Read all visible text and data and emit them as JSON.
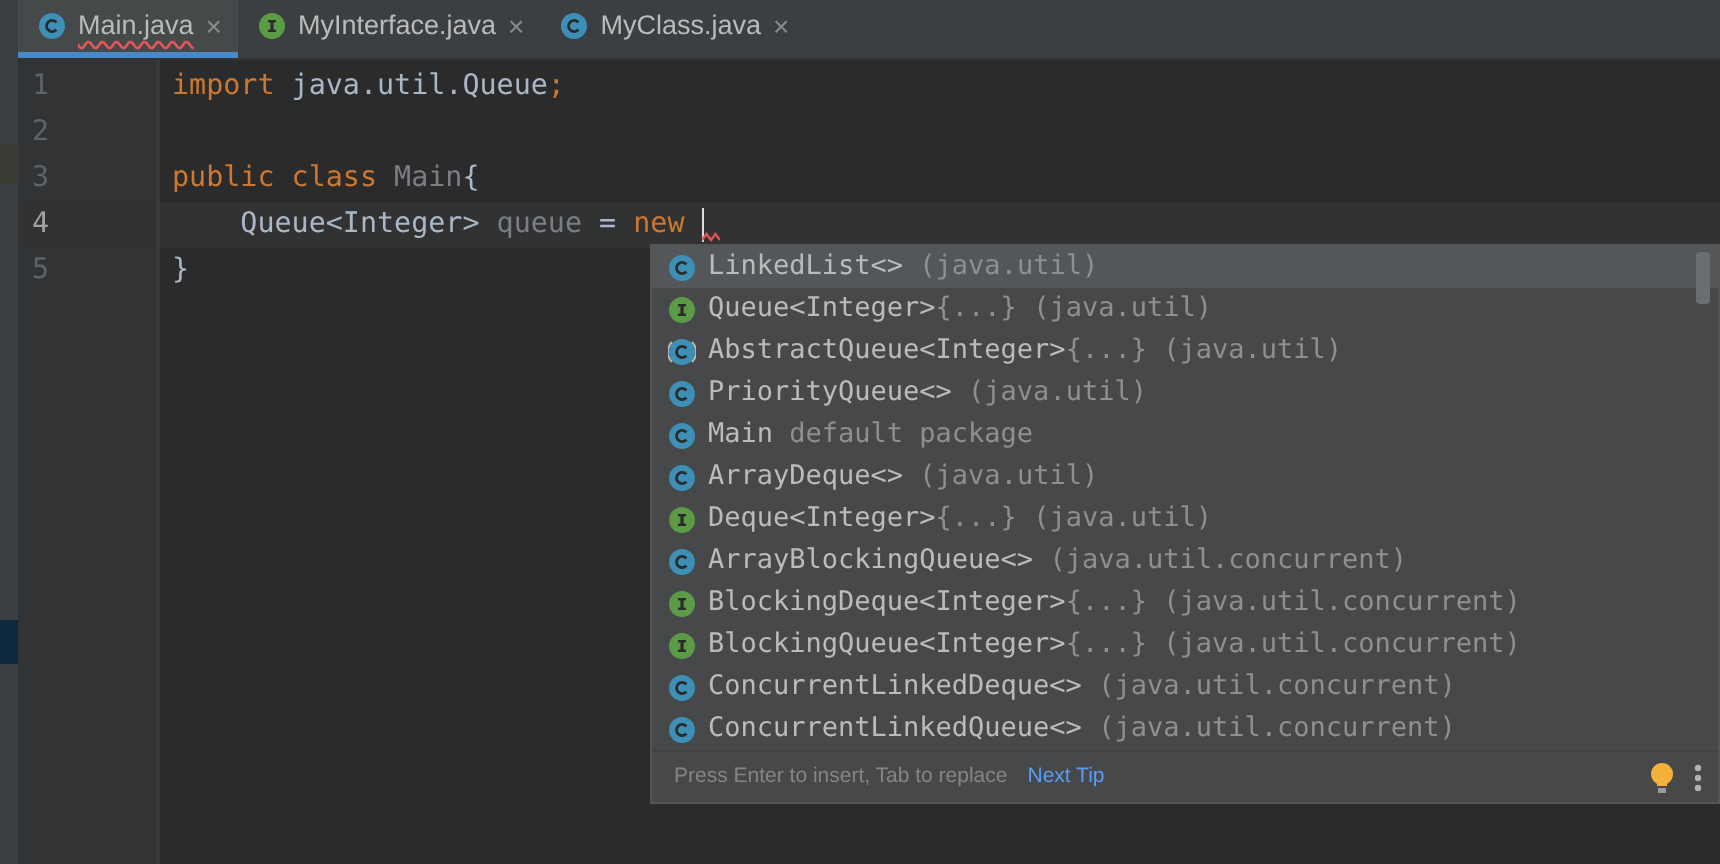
{
  "tabs": [
    {
      "label": "Main.java",
      "kind": "class",
      "selected": true,
      "has_error": true,
      "close": "×"
    },
    {
      "label": "MyInterface.java",
      "kind": "interface",
      "selected": false,
      "has_error": false,
      "close": "×"
    },
    {
      "label": "MyClass.java",
      "kind": "class",
      "selected": false,
      "has_error": false,
      "close": "×"
    }
  ],
  "editor": {
    "lines": [
      {
        "number": "1",
        "current": false,
        "tokens": [
          {
            "kind": "keyword",
            "text": "import"
          },
          {
            "kind": "plain",
            "text": " java.util.Queue"
          },
          {
            "kind": "keyword",
            "text": ";"
          }
        ]
      },
      {
        "number": "2",
        "current": false
      },
      {
        "number": "3",
        "current": false,
        "tokens": [
          {
            "kind": "keyword",
            "text": "public class"
          },
          {
            "kind": "unused",
            "text": " Main"
          },
          {
            "kind": "plain",
            "text": "{"
          }
        ]
      },
      {
        "number": "4",
        "current": true,
        "caret": true,
        "tokens": [
          {
            "kind": "plain",
            "text": "    Queue<Integer>"
          },
          {
            "kind": "unused",
            "text": " queue"
          },
          {
            "kind": "plain",
            "text": " = "
          },
          {
            "kind": "keyword",
            "text": "new"
          }
        ]
      },
      {
        "number": "5",
        "current": false,
        "tokens": [
          {
            "kind": "plain",
            "text": "}"
          }
        ]
      }
    ]
  },
  "completion": {
    "items": [
      {
        "kind": "class",
        "name": "LinkedList<>",
        "detail": "(java.util)",
        "selected": true
      },
      {
        "kind": "interface",
        "name": "Queue<Integer>",
        "suffix": "{...}",
        "detail": "(java.util)",
        "selected": false
      },
      {
        "kind": "abstract",
        "name": "AbstractQueue<Integer>",
        "suffix": "{...}",
        "detail": "(java.util)",
        "selected": false
      },
      {
        "kind": "class",
        "name": "PriorityQueue<>",
        "detail": "(java.util)",
        "selected": false
      },
      {
        "kind": "class",
        "name": "Main",
        "detail": "default package",
        "selected": false
      },
      {
        "kind": "class",
        "name": "ArrayDeque<>",
        "detail": "(java.util)",
        "selected": false
      },
      {
        "kind": "interface",
        "name": "Deque<Integer>",
        "suffix": "{...}",
        "detail": "(java.util)",
        "selected": false
      },
      {
        "kind": "class",
        "name": "ArrayBlockingQueue<>",
        "detail": "(java.util.concurrent)",
        "selected": false
      },
      {
        "kind": "interface",
        "name": "BlockingDeque<Integer>",
        "suffix": "{...}",
        "detail": "(java.util.concurrent)",
        "selected": false
      },
      {
        "kind": "interface",
        "name": "BlockingQueue<Integer>",
        "suffix": "{...}",
        "detail": "(java.util.concurrent)",
        "selected": false
      },
      {
        "kind": "class",
        "name": "ConcurrentLinkedDeque<>",
        "detail": "(java.util.concurrent)",
        "selected": false
      },
      {
        "kind": "class",
        "name": "ConcurrentLinkedQueue<>",
        "detail": "(java.util.concurrent)",
        "selected": false
      }
    ],
    "hint": "Press Enter to insert, Tab to replace",
    "tip_link": "Next Tip"
  }
}
